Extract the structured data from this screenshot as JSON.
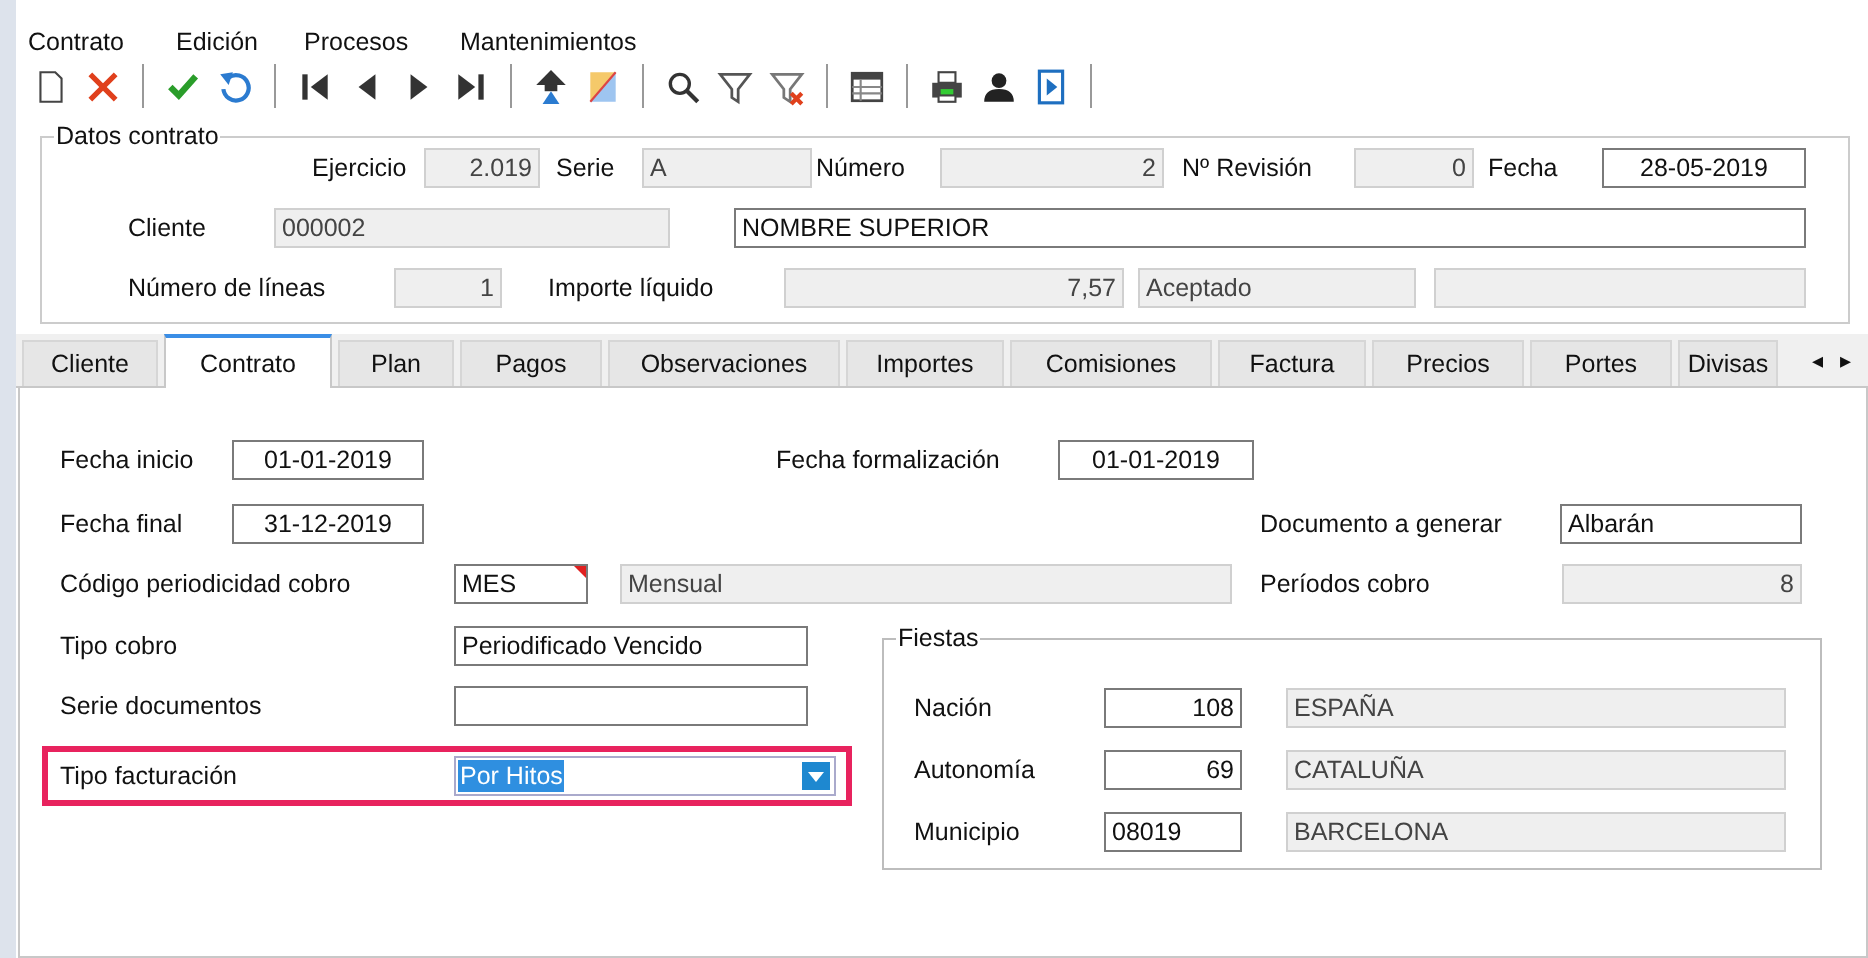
{
  "menu": [
    {
      "label": "Contrato"
    },
    {
      "label": "Edición"
    },
    {
      "label": "Procesos"
    },
    {
      "label": "Mantenimientos"
    }
  ],
  "header": {
    "title": "Datos contrato",
    "rows": [
      {
        "items": [
          {
            "label": "Ejercicio",
            "kind": "field",
            "value": "2.019",
            "disabled": true
          },
          {
            "label": "Serie",
            "kind": "field",
            "value": "A",
            "disabled": true
          },
          {
            "label": "Número",
            "kind": "field",
            "value": "2",
            "disabled": true
          },
          {
            "label": "Nº Revisión",
            "kind": "field",
            "value": "0",
            "disabled": true
          },
          {
            "label": "Fecha",
            "kind": "field",
            "value": "28-05-2019",
            "disabled": false
          }
        ]
      },
      {
        "items": [
          {
            "label": "Cliente",
            "kind": "field",
            "value": "000002",
            "disabled": true
          },
          {
            "kind": "field",
            "value": "NOMBRE SUPERIOR",
            "disabled": false
          }
        ]
      },
      {
        "items": [
          {
            "label": "Número de líneas",
            "kind": "field",
            "value": "1",
            "disabled": true
          },
          {
            "label": "Importe líquido",
            "kind": "field",
            "value": "7,57",
            "disabled": true
          },
          {
            "kind": "field",
            "value": "Aceptado",
            "disabled": true
          },
          {
            "kind": "field",
            "disabled": true
          }
        ]
      }
    ]
  },
  "tabs": [
    {
      "label": "Cliente",
      "selected": false
    },
    {
      "label": "Contrato",
      "selected": true
    },
    {
      "label": "Plan",
      "selected": false
    },
    {
      "label": "Pagos",
      "selected": false
    },
    {
      "label": "Observaciones",
      "selected": false
    },
    {
      "label": "Importes",
      "selected": false
    },
    {
      "label": "Comisiones",
      "selected": false
    },
    {
      "label": "Factura",
      "selected": false
    },
    {
      "label": "Precios",
      "selected": false
    },
    {
      "label": "Portes",
      "selected": false
    },
    {
      "label": "Divisas",
      "selected": false
    }
  ],
  "tab_scroll": [
    "◂",
    "▸"
  ],
  "contract": {
    "rows": [
      {
        "items": [
          {
            "label": "Fecha inicio",
            "kind": "field",
            "value": "01-01-2019",
            "disabled": false
          },
          {
            "label": "Fecha formalización",
            "kind": "field",
            "value": "01-01-2019",
            "disabled": false
          }
        ]
      },
      {
        "items": [
          {
            "label": "Fecha final",
            "kind": "field",
            "value": "31-12-2019",
            "disabled": false
          },
          {
            "label": "Documento a generar",
            "kind": "field",
            "value": "Albarán",
            "disabled": false
          }
        ]
      },
      {
        "items": [
          {
            "label": "Código periodicidad cobro",
            "kind": "field",
            "value": "MES",
            "disabled": false,
            "required": true
          },
          {
            "kind": "field",
            "value": "Mensual",
            "disabled": true
          },
          {
            "label": "Períodos cobro",
            "kind": "field",
            "value": "8",
            "disabled": true
          }
        ]
      }
    ],
    "left_rows": [
      {
        "highlighted": false,
        "items": [
          {
            "label": "Tipo cobro",
            "kind": "field",
            "value": "Periodificado Vencido",
            "disabled": false
          }
        ]
      },
      {
        "highlighted": false,
        "items": [
          {
            "label": "Serie documentos",
            "kind": "field",
            "disabled": false
          }
        ]
      },
      {
        "highlighted": true,
        "items": [
          {
            "label": "Tipo facturación",
            "kind": "dropdown",
            "value": "Por Hitos",
            "text_selected": true
          }
        ]
      }
    ],
    "fiestas": {
      "title": "Fiestas",
      "rows": [
        {
          "items": [
            {
              "label": "Nación",
              "kind": "field",
              "value": "108",
              "disabled": false
            },
            {
              "kind": "field",
              "value": "ESPAÑA",
              "disabled": true
            }
          ]
        },
        {
          "items": [
            {
              "label": "Autonomía",
              "kind": "field",
              "value": "69",
              "disabled": false
            },
            {
              "kind": "field",
              "value": "CATALUÑA",
              "disabled": true
            }
          ]
        },
        {
          "items": [
            {
              "label": "Municipio",
              "kind": "field",
              "value": "08019",
              "disabled": false
            },
            {
              "kind": "field",
              "value": "BARCELONA",
              "disabled": true
            }
          ]
        }
      ]
    }
  }
}
